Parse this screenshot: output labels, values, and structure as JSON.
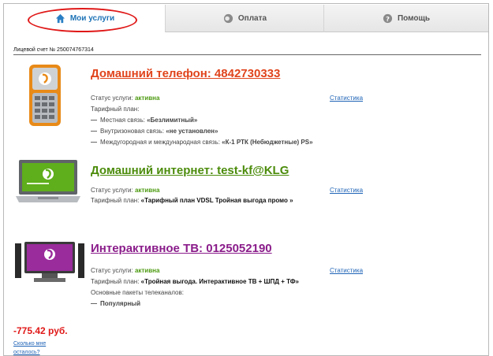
{
  "tabs": [
    {
      "label": "Мои услуги",
      "icon": "home-icon",
      "active": true
    },
    {
      "label": "Оплата",
      "icon": "payment-icon",
      "active": false
    },
    {
      "label": "Помощь",
      "icon": "help-icon",
      "active": false
    }
  ],
  "account": {
    "label": "Лицевой счет № 250074767314"
  },
  "services": [
    {
      "title": "Домашний телефон: 4842730333",
      "status_label": "Статус услуги:",
      "status_value": "активна",
      "stat_link": "Статистика",
      "plan_label": "Тарифный план:",
      "details": [
        {
          "label": "Местная связь:",
          "value": "«Безлимитный»"
        },
        {
          "label": "Внутризоновая связь:",
          "value": "«не установлен»"
        },
        {
          "label": "Междугородная и международная связь:",
          "value": "«К-1 РТК (Небюджетные) PS»"
        }
      ]
    },
    {
      "title": "Домашний интернет: test-kf@KLG",
      "status_label": "Статус услуги:",
      "status_value": "активна",
      "stat_link": "Статистика",
      "plan_label": "Тарифный план:",
      "plan_value": "«Тарифный план VDSL Тройная выгода промо »"
    },
    {
      "title": "Интерактивное ТВ: 0125052190",
      "status_label": "Статус услуги:",
      "status_value": "активна",
      "stat_link": "Статистика",
      "plan_label": "Тарифный план:",
      "plan_value": "«Тройная выгода. Интерактивное ТВ + ШПД + ТФ»",
      "packages_label": "Основные пакеты телеканалов:",
      "packages": [
        "Популярный"
      ]
    }
  ],
  "balance": "-775.42 руб.",
  "links": [
    "Сколько мне",
    "осталось?"
  ],
  "colors": {
    "phone_title": "#e0441c",
    "internet_title": "#4c8c0c",
    "tv_title": "#8a1c8a",
    "accent_link": "#1e63b6",
    "highlight_ring": "#e01818"
  }
}
